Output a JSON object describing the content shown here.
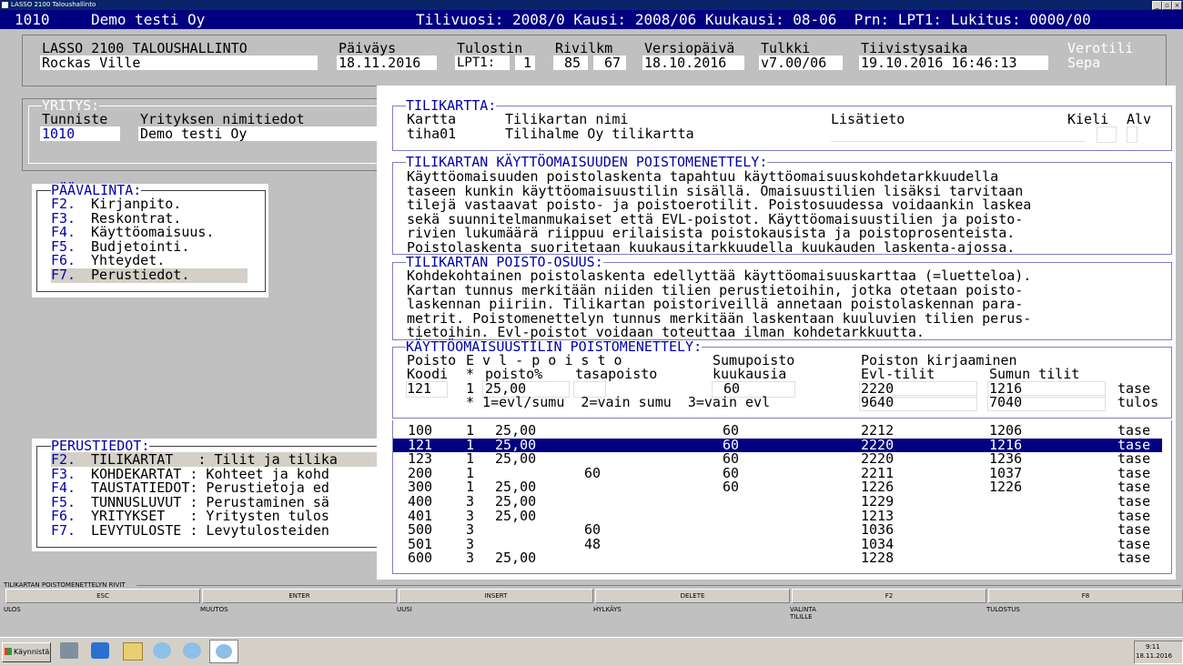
{
  "window": {
    "title": "LASSO 2100 Taloushallinto"
  },
  "status": {
    "company_code": "1010",
    "company_name": "Demo testi Oy",
    "info": "Tilivuosi: 2008/0 Kausi: 2008/06 Kuukausi: 08-06  Prn: LPT1: Lukitus: 0000/00"
  },
  "header": {
    "app_label": "LASSO 2100 TALOUSHALLINTO",
    "user": "Rockas Ville",
    "paivays_label": "Päiväys",
    "paivays": "18.11.2016",
    "tulostin_label": "Tulostin",
    "tulostin": "LPT1:",
    "tulostin_num": "1",
    "rivilkm_label": "Rivilkm",
    "rivilkm_a": "85",
    "rivilkm_b": "67",
    "versiopaiva_label": "Versiopäivä",
    "versiopaiva": "18.10.2016",
    "tulkki_label": "Tulkki",
    "tulkki": "v7.00/06",
    "tiivistysaika_label": "Tiivistysaika",
    "tiivistysaika": "19.10.2016 16:46:13",
    "verotili_label": "Verotili",
    "verotili": "Sepa"
  },
  "yritys": {
    "legend": "YRITYS:",
    "tunniste_label": "Tunniste",
    "nimitiedot_label": "Yrityksen nimitiedot",
    "tunniste": "1010",
    "nimi": "Demo testi Oy"
  },
  "paavalinta": {
    "legend": "PÄÄVALINTA:",
    "items": [
      {
        "key": "F2.",
        "label": "Kirjanpito."
      },
      {
        "key": "F3.",
        "label": "Reskontrat."
      },
      {
        "key": "F4.",
        "label": "Käyttöomaisuus."
      },
      {
        "key": "F5.",
        "label": "Budjetointi."
      },
      {
        "key": "F6.",
        "label": "Yhteydet."
      },
      {
        "key": "F7.",
        "label": "Perustiedot."
      }
    ]
  },
  "perustiedot": {
    "legend": "PERUSTIEDOT:",
    "items": [
      {
        "key": "F2.",
        "label": "TILIKARTAT   : Tilit ja tilika"
      },
      {
        "key": "F3.",
        "label": "KOHDEKARTAT : Kohteet ja kohd"
      },
      {
        "key": "F4.",
        "label": "TAUSTATIEDOT: Perustietoja ed"
      },
      {
        "key": "F5.",
        "label": "TUNNUSLUVUT : Perustaminen sä"
      },
      {
        "key": "F6.",
        "label": "YRITYKSET   : Yritysten tulos"
      },
      {
        "key": "F7.",
        "label": "LEVYTULOSTE : Levytulosteiden"
      }
    ]
  },
  "tilikartta": {
    "legend": "TILIKARTTA:",
    "kartta_label": "Kartta",
    "nimi_label": "Tilikartan nimi",
    "lisatieto_label": "Lisätieto",
    "kieli_label": "Kieli",
    "alv_label": "Alv",
    "kartta": "tiha01",
    "nimi": "Tilihalme Oy tilikartta",
    "lisatieto": "",
    "kieli": "",
    "alv": ""
  },
  "poistomenettely": {
    "legend": "TILIKARTAN KÄYTTÖOMAISUUDEN POISTOMENETTELY:",
    "lines": [
      "Käyttöomaisuuden poistolaskenta tapahtuu käyttöomaisuuskohdetarkkuudella",
      "taseen kunkin käyttöomaisuustilin sisällä. Omaisuustilien lisäksi tarvitaan",
      "tilejä vastaavat poisto- ja poistoerotilit. Poistosuudessa voidaankin laskea",
      "sekä suunnitelmanmukaiset että EVL-poistot. Käyttöomaisuustilien ja poisto-",
      "rivien lukumäärä riippuu erilaisista poistokausista ja poistoprosenteista.",
      "Poistolaskenta suoritetaan kuukausitarkkuudella kuukauden laskenta-ajossa."
    ]
  },
  "poisto_osuus": {
    "legend": "TILIKARTAN POISTO-OSUUS:",
    "lines": [
      "Kohdekohtainen poistolaskenta edellyttää käyttöomaisuuskarttaa (=luetteloa).",
      "Kartan tunnus merkitään niiden tilien perustietoihin, jotka otetaan poisto-",
      "laskennan piiriin. Tilikartan poistoriveillä annetaan poistolaskennan para-",
      "metrit. Poistomenettelyn tunnus merkitään laskentaan kuuluvien tilien perus-",
      "tietoihin. Evl-poistot voidaan toteuttaa ilman kohdetarkkuutta."
    ]
  },
  "kayttoomaisuustili": {
    "legend": "KÄYTTÖOMAISUUSTILIN POISTOMENETTELY:",
    "h1_poisto": "Poisto",
    "h1_evl": "E v l - p o i s t o",
    "h1_sumupoisto": "Sumupoisto",
    "h1_kirjaaminen": "Poiston kirjaaminen",
    "h2_koodi": "Koodi",
    "h2_star": "*",
    "h2_poistopct": "poisto%",
    "h2_tasapoisto": "tasapoisto",
    "h2_kuukausia": "kuukausia",
    "h2_evltilit": "Evl-tilit",
    "h2_sumuntilit": "Sumun tilit",
    "koodi": "121",
    "star": "1",
    "poistopct": "25,00",
    "tasapoisto": "",
    "kuukausia": "60",
    "evl1": "2220",
    "sumu1": "1216",
    "tase1": "tase",
    "legend_line": "* 1=evl/sumu  2=vain sumu  3=vain evl",
    "evl2": "9640",
    "sumu2": "7040",
    "tase2": "tulos"
  },
  "rows": [
    {
      "koodi": "100",
      "t": "1",
      "pct": "25,00",
      "tasa": "",
      "kk": "60",
      "evl": "2212",
      "sumu": "1206",
      "tyyppi": "tase"
    },
    {
      "koodi": "121",
      "t": "1",
      "pct": "25,00",
      "tasa": "",
      "kk": "60",
      "evl": "2220",
      "sumu": "1216",
      "tyyppi": "tase"
    },
    {
      "koodi": "123",
      "t": "1",
      "pct": "25,00",
      "tasa": "",
      "kk": "60",
      "evl": "2220",
      "sumu": "1236",
      "tyyppi": "tase"
    },
    {
      "koodi": "200",
      "t": "1",
      "pct": "",
      "tasa": "60",
      "kk": "60",
      "evl": "2211",
      "sumu": "1037",
      "tyyppi": "tase"
    },
    {
      "koodi": "300",
      "t": "1",
      "pct": "25,00",
      "tasa": "",
      "kk": "60",
      "evl": "1226",
      "sumu": "1226",
      "tyyppi": "tase"
    },
    {
      "koodi": "400",
      "t": "3",
      "pct": "25,00",
      "tasa": "",
      "kk": "",
      "evl": "1229",
      "sumu": "",
      "tyyppi": "tase"
    },
    {
      "koodi": "401",
      "t": "3",
      "pct": "25,00",
      "tasa": "",
      "kk": "",
      "evl": "1213",
      "sumu": "",
      "tyyppi": "tase"
    },
    {
      "koodi": "500",
      "t": "3",
      "pct": "",
      "tasa": "60",
      "kk": "",
      "evl": "1036",
      "sumu": "",
      "tyyppi": "tase"
    },
    {
      "koodi": "501",
      "t": "3",
      "pct": "",
      "tasa": "48",
      "kk": "",
      "evl": "1034",
      "sumu": "",
      "tyyppi": "tase"
    },
    {
      "koodi": "600",
      "t": "3",
      "pct": "25,00",
      "tasa": "",
      "kk": "",
      "evl": "1228",
      "sumu": "",
      "tyyppi": "tase"
    }
  ],
  "selected_row": 1,
  "fkeys": {
    "section_label": "TILIKARTAN POISTOMENETTELYN RIVIT",
    "keys": [
      {
        "key": "ESC",
        "desc": "ULOS"
      },
      {
        "key": "ENTER",
        "desc": "MUUTOS"
      },
      {
        "key": "INSERT",
        "desc": "UUSI"
      },
      {
        "key": "DELETE",
        "desc": "HYLKÄYS"
      },
      {
        "key": "F2",
        "desc": "VALINTA TILILLE"
      },
      {
        "key": "F8",
        "desc": "TULOSTUS"
      }
    ]
  },
  "taskbar": {
    "start": "Käynnistä",
    "time": "9:11",
    "date": "18.11.2016"
  },
  "colors": {
    "status_bg": "#000080",
    "blue_text": "#0000a8",
    "highlight": "#000080",
    "panel": "#c0c0c0"
  }
}
